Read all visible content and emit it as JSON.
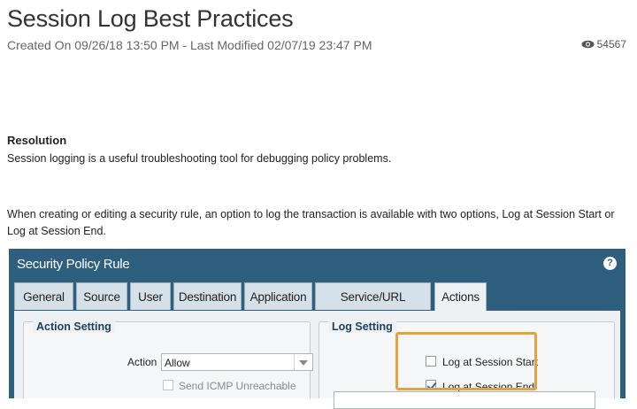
{
  "article": {
    "title": "Session Log Best Practices",
    "meta": "Created On 09/26/18 13:50 PM - Last Modified 02/07/19 23:47 PM",
    "views": "54567",
    "view_icon": "eye-icon",
    "resolution_heading": "Resolution",
    "paragraph_1": "Session logging is a useful troubleshooting tool for debugging policy problems.",
    "paragraph_2": "When creating or editing a security rule, an option to log the transaction is available with two options, Log at Session Start or Log at Session End."
  },
  "dialog": {
    "title": "Security Policy Rule",
    "help_icon": "help-icon",
    "help_glyph": "?",
    "tabs": [
      "General",
      "Source",
      "User",
      "Destination",
      "Application",
      "Service/URL Category",
      "Actions"
    ],
    "active_tab": "Actions",
    "action_setting": {
      "legend": "Action Setting",
      "action_label": "Action",
      "action_value": "Allow",
      "send_icmp_label": "Send ICMP Unreachable",
      "send_icmp_checked": false
    },
    "log_setting": {
      "legend": "Log Setting",
      "log_start_label": "Log at Session Start",
      "log_start_checked": false,
      "log_end_label": "Log at Session End",
      "log_end_checked": true
    }
  },
  "colors": {
    "dialog_header": "#2f5f7f",
    "highlight": "#e4a23c",
    "tab": "#d6e0e8"
  }
}
